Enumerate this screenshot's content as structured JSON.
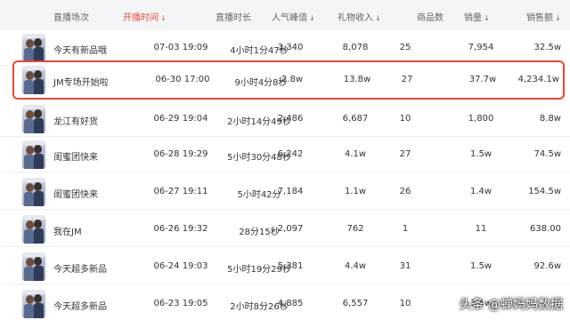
{
  "columns": {
    "stream": "直播场次",
    "start_time": "开播时间",
    "duration": "直播时长",
    "peak_viewers": "人气峰值",
    "gift_income": "礼物收入",
    "product_count": "商品数",
    "sales_volume": "销量",
    "sales_amount": "销售额"
  },
  "sort_arrow": "↓",
  "sorted_column": "start_time",
  "highlight_color": "#e8453c",
  "sort_color": "#f04b3c",
  "rows": [
    {
      "title": "今天有新品哦",
      "start_time": "07-03 19:09",
      "duration": "4小时1分47秒",
      "peak_viewers": "3,340",
      "gift_income": "8,078",
      "product_count": "25",
      "sales_volume": "7,954",
      "sales_amount": "32.5w",
      "highlighted": false
    },
    {
      "title": "JM专场开始啦",
      "start_time": "06-30 17:00",
      "duration": "9小时4分8秒",
      "peak_viewers": "2.8w",
      "gift_income": "13.8w",
      "product_count": "27",
      "sales_volume": "37.7w",
      "sales_amount": "4,234.1w",
      "highlighted": true
    },
    {
      "title": "龙江有好货",
      "start_time": "06-29 19:04",
      "duration": "2小时14分49秒",
      "peak_viewers": "2,486",
      "gift_income": "6,687",
      "product_count": "10",
      "sales_volume": "1,800",
      "sales_amount": "8.8w",
      "highlighted": false
    },
    {
      "title": "闺蜜团快来",
      "start_time": "06-28 19:29",
      "duration": "5小时30分48秒",
      "peak_viewers": "6,242",
      "gift_income": "4.1w",
      "product_count": "27",
      "sales_volume": "1.5w",
      "sales_amount": "74.5w",
      "highlighted": false
    },
    {
      "title": "闺蜜团快来",
      "start_time": "06-27 19:11",
      "duration": "5小时42分",
      "peak_viewers": "7,184",
      "gift_income": "1.1w",
      "product_count": "26",
      "sales_volume": "1.4w",
      "sales_amount": "154.5w",
      "highlighted": false
    },
    {
      "title": "我在JM",
      "start_time": "06-26 19:32",
      "duration": "28分15秒",
      "peak_viewers": "2,097",
      "gift_income": "762",
      "product_count": "1",
      "sales_volume": "11",
      "sales_amount": "638.00",
      "highlighted": false
    },
    {
      "title": "今天超多新品",
      "start_time": "06-24 19:03",
      "duration": "5小时19分29秒",
      "peak_viewers": "5,381",
      "gift_income": "4.4w",
      "product_count": "31",
      "sales_volume": "1.5w",
      "sales_amount": "92.6w",
      "highlighted": false
    },
    {
      "title": "今天超多新品",
      "start_time": "06-23 19:05",
      "duration": "2小时8分26秒",
      "peak_viewers": "4,885",
      "gift_income": "6,557",
      "product_count": "10",
      "sales_volume": "1.5w",
      "sales_amount": "",
      "highlighted": false
    }
  ],
  "watermark": "头条 @蝉妈妈数据"
}
